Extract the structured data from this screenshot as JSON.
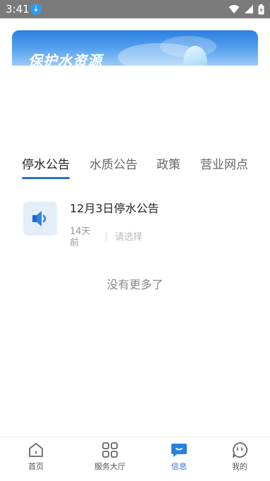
{
  "status_bar": {
    "time": "3:41",
    "icons": [
      "download-icon",
      "wifi-icon",
      "signal-icon",
      "battery-icon"
    ]
  },
  "banner": {
    "title": "保护水资源"
  },
  "tabs": [
    {
      "label": "停水公告",
      "active": true
    },
    {
      "label": "水质公告",
      "active": false
    },
    {
      "label": "政策",
      "active": false
    },
    {
      "label": "营业网点",
      "active": false
    }
  ],
  "notices": [
    {
      "icon": "speaker-icon",
      "title": "12月3日停水公告",
      "time": "14天前",
      "category_placeholder": "请选择"
    }
  ],
  "list_end_text": "没有更多了",
  "bottom_nav": [
    {
      "label": "首页",
      "icon": "home-icon",
      "active": false
    },
    {
      "label": "服务大厅",
      "icon": "grid-icon",
      "active": false
    },
    {
      "label": "信息",
      "icon": "message-icon",
      "active": true
    },
    {
      "label": "我的",
      "icon": "profile-icon",
      "active": false
    }
  ],
  "colors": {
    "accent": "#2b6fd1",
    "status_bar": "#7a7a7a"
  }
}
